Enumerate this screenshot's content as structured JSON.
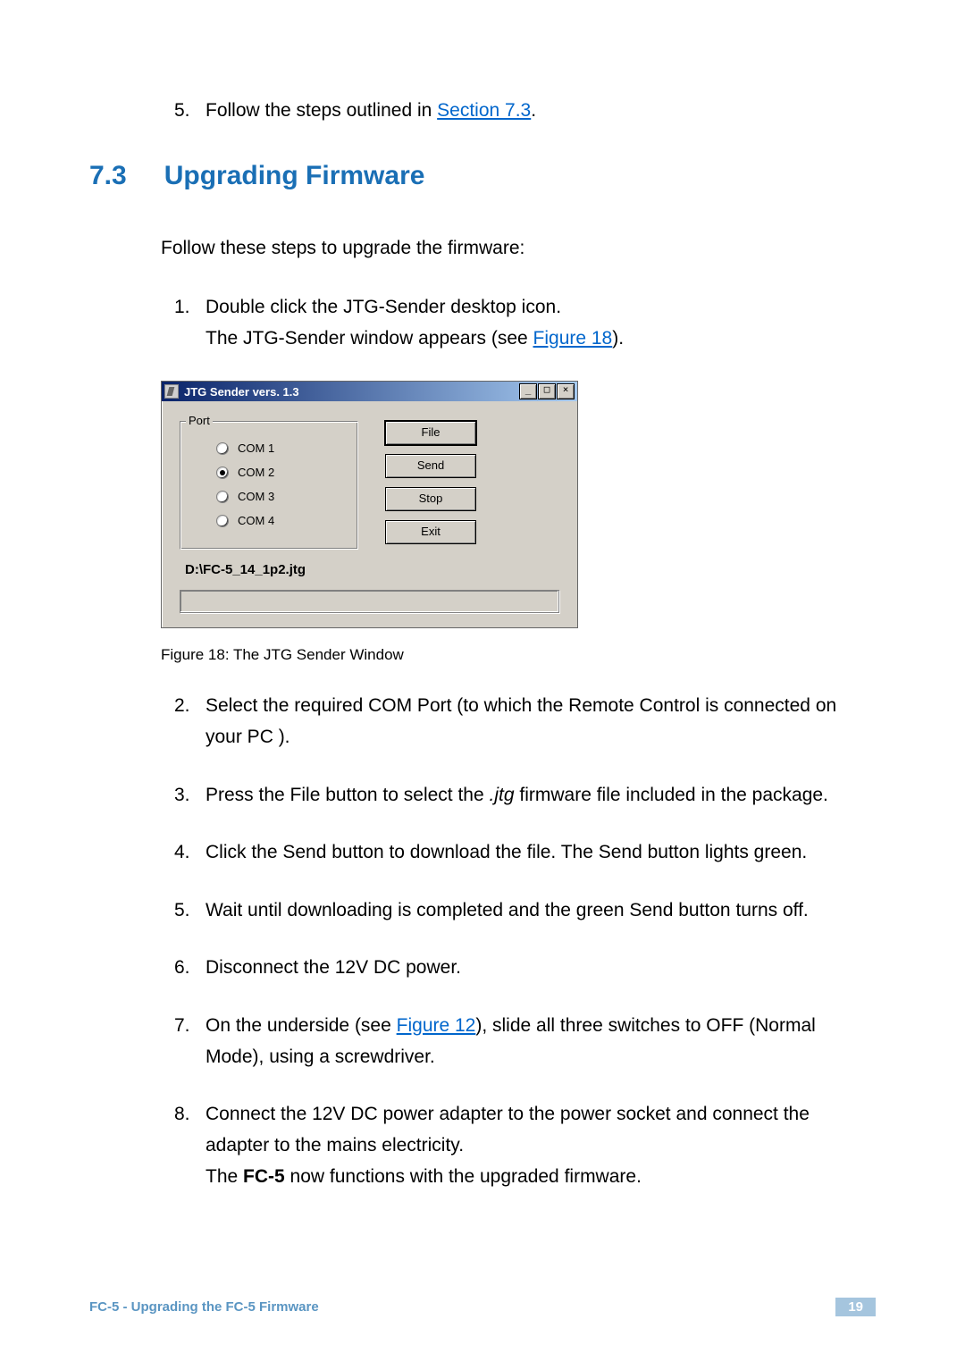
{
  "preList": {
    "num": "5.",
    "textBefore": "Follow the steps outlined in ",
    "link": "Section 7.3",
    "textAfter": "."
  },
  "section": {
    "number": "7.3",
    "title": "Upgrading Firmware"
  },
  "intro": "Follow these steps to upgrade the firmware:",
  "step1": {
    "num": "1.",
    "line1": "Double click the JTG-Sender desktop icon.",
    "line2a": "The JTG-Sender window appears (see ",
    "link": "Figure 18",
    "line2b": ")."
  },
  "jtgWindow": {
    "title": "JTG Sender vers. 1.3",
    "minimize": "_",
    "maximize": "□",
    "close": "×",
    "groupLabel": "Port",
    "com1": "COM 1",
    "com2": "COM 2",
    "com3": "COM 3",
    "com4": "COM 4",
    "fileBtn": "File",
    "sendBtn": "Send",
    "stopBtn": "Stop",
    "exitBtn": "Exit",
    "filePath": "D:\\FC-5_14_1p2.jtg"
  },
  "figCaption": "Figure 18: The JTG Sender Window",
  "step2": {
    "num": "2.",
    "text": "Select the required COM Port (to which the Remote Control is connected on your PC )."
  },
  "step3": {
    "num": "3.",
    "a": "Press the File button to select the ",
    "italic": ".jtg",
    "b": " firmware file included in the package."
  },
  "step4": {
    "num": "4.",
    "text": "Click the Send button to download the file. The Send button lights green."
  },
  "step5": {
    "num": "5.",
    "text": "Wait until downloading is completed and the green Send button turns off."
  },
  "step6": {
    "num": "6.",
    "text": "Disconnect the 12V DC power."
  },
  "step7": {
    "num": "7.",
    "a": "On the underside (see ",
    "link": "Figure 12",
    "b": "), slide all three switches to OFF (Normal Mode), using a screwdriver."
  },
  "step8": {
    "num": "8.",
    "line1": "Connect the 12V DC power adapter to the power socket and connect the adapter to the mains electricity.",
    "line2a": "The ",
    "bold": "FC-5",
    "line2b": " now functions with the upgraded firmware."
  },
  "footer": {
    "text": "FC-5 - Upgrading the FC-5 Firmware",
    "pageNum": "19"
  }
}
